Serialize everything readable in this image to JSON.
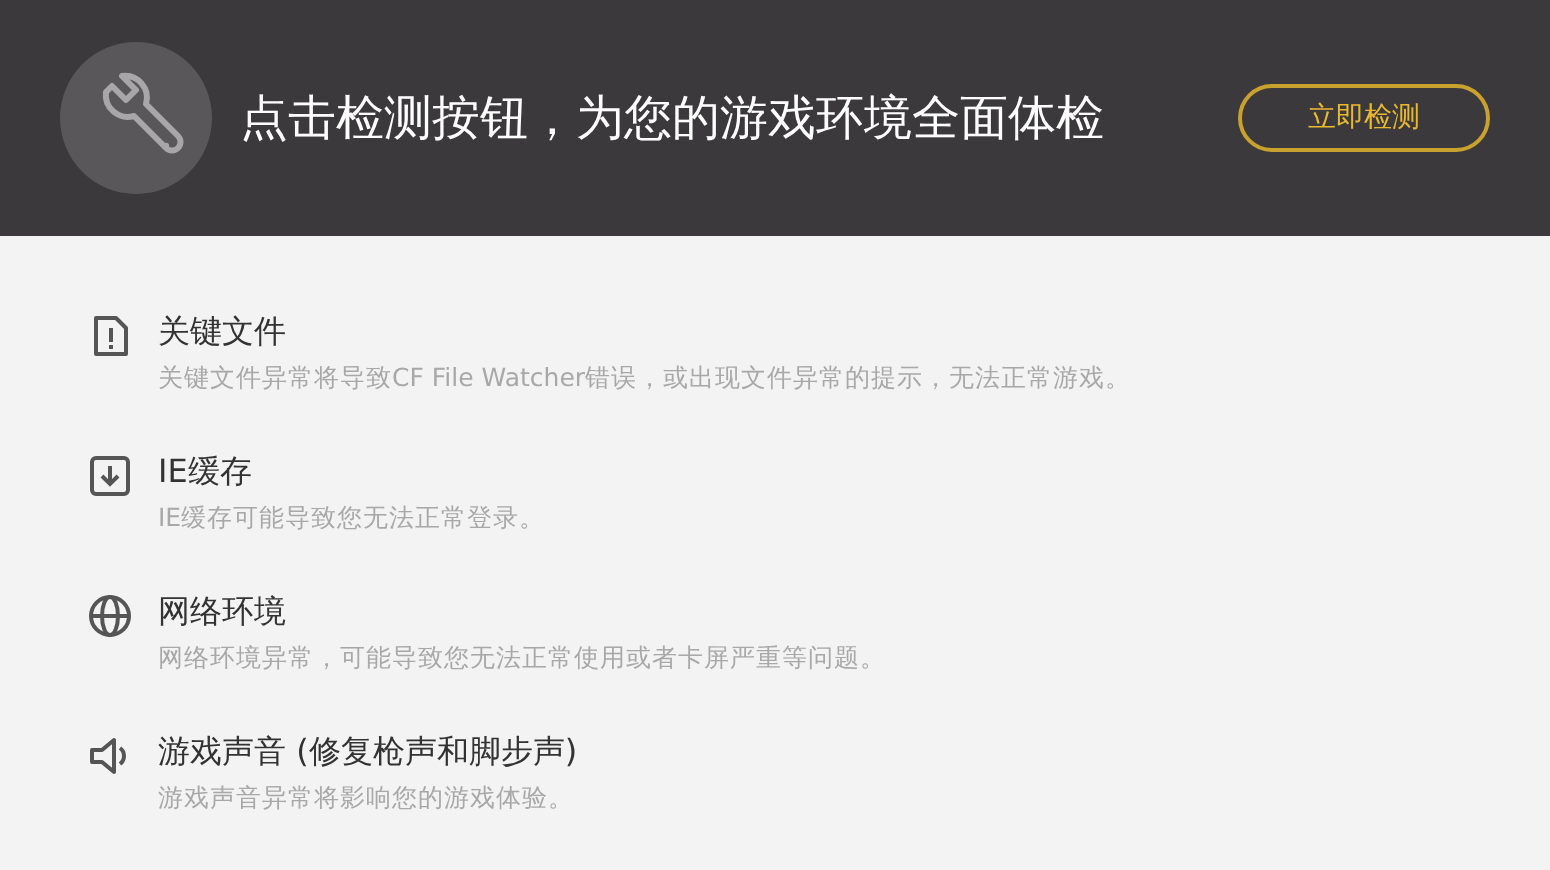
{
  "header": {
    "title": "点击检测按钮，为您的游戏环境全面体检",
    "button": "立即检测"
  },
  "checks": [
    {
      "kind": "file",
      "title": "关键文件",
      "description": "关键文件异常将导致CF File Watcher错误，或出现文件异常的提示，无法正常游戏。"
    },
    {
      "kind": "cache",
      "title": "IE缓存",
      "description": "IE缓存可能导致您无法正常登录。"
    },
    {
      "kind": "network",
      "title": "网络环境",
      "description": "网络环境异常，可能导致您无法正常使用或者卡屏严重等问题。"
    },
    {
      "kind": "sound",
      "title": "游戏声音 (修复枪声和脚步声)",
      "description": "游戏声音异常将影响您的游戏体验。"
    }
  ]
}
